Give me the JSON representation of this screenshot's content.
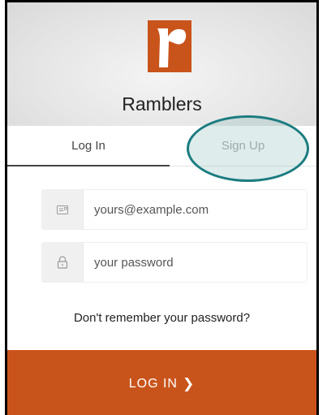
{
  "header": {
    "brand_name": "Ramblers",
    "logo_icon": "ramblers-r-logo",
    "logo_color": "#c9541b"
  },
  "tabs": [
    {
      "label": "Log In",
      "active": true
    },
    {
      "label": "Sign Up",
      "active": false,
      "highlighted": true
    }
  ],
  "form": {
    "email": {
      "icon": "email-icon",
      "placeholder": "yours@example.com",
      "value": ""
    },
    "password": {
      "icon": "lock-icon",
      "placeholder": "your password",
      "value": ""
    },
    "forgot_link": "Don't remember your password?"
  },
  "submit": {
    "label": "LOG IN",
    "icon": "chevron-right-icon",
    "color": "#c9541b"
  },
  "annotation": {
    "ring_color": "#1b7c80"
  }
}
